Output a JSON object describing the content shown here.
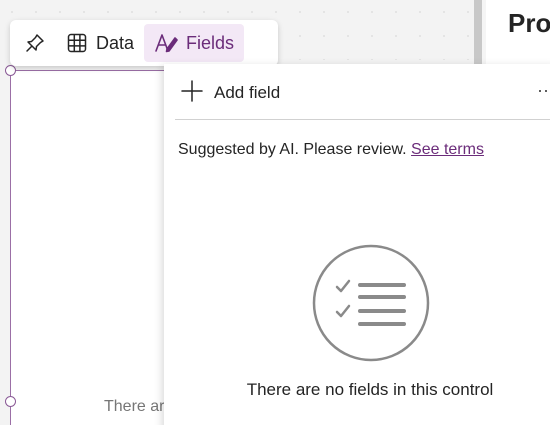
{
  "toolbar": {
    "pin_icon": "pin-icon",
    "data_label": "Data",
    "data_icon": "table-icon",
    "fields_label": "Fields",
    "fields_icon": "fields-pen-icon"
  },
  "flyout": {
    "add_field_label": "Add field",
    "more_label": "···",
    "ai_note": "Suggested by AI. Please review.",
    "see_terms": "See terms",
    "empty_message": "There are no fields in this control",
    "empty_icon": "checklist-icon"
  },
  "control": {
    "empty_text_partial": "There ar"
  },
  "right_pane": {
    "title_partial": "Pro"
  },
  "colors": {
    "accent": "#6b2c7a",
    "active_bg": "#f3e8f6",
    "selection": "#9b6fa6"
  }
}
